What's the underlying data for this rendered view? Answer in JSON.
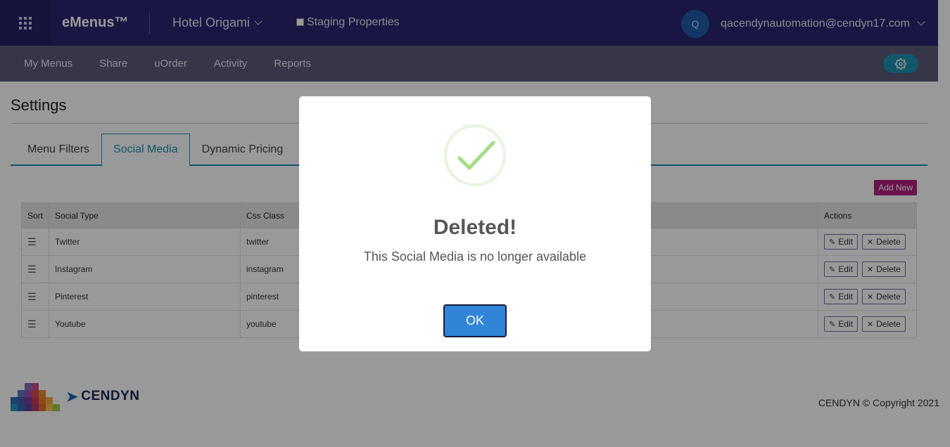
{
  "header": {
    "brand": "eMenus™",
    "hotel": "Hotel Origami",
    "staging_label": "Staging Properties",
    "avatar_initial": "Q",
    "email": "qacendynautomation@cendyn17.com"
  },
  "nav": {
    "items": [
      "My Menus",
      "Share",
      "uOrder",
      "Activity",
      "Reports"
    ]
  },
  "page": {
    "title": "Settings",
    "tabs": [
      "Menu Filters",
      "Social Media",
      "Dynamic Pricing"
    ],
    "active_tab": "Social Media",
    "add_new_label": "Add New"
  },
  "table": {
    "columns": [
      "Sort",
      "Social Type",
      "Css Class",
      "Actions"
    ],
    "rows": [
      {
        "type": "Twitter",
        "css": "twitter"
      },
      {
        "type": "Instagram",
        "css": "instagram"
      },
      {
        "type": "Pinterest",
        "css": "pinterest"
      },
      {
        "type": "Youtube",
        "css": "youtube"
      }
    ],
    "edit_label": "Edit",
    "delete_label": "Delete"
  },
  "footer": {
    "logo_text": "CENDYN",
    "copyright": "CENDYN © Copyright 2021"
  },
  "modal": {
    "title": "Deleted!",
    "text": "This Social Media is no longer available",
    "ok_label": "OK"
  },
  "colors": {
    "topbar": "#2a2570",
    "navbar": "#5b5a78",
    "accent": "#1e8fb5",
    "add_new": "#b0217c",
    "ok_button": "#3085d6",
    "success": "#a5dc86"
  }
}
